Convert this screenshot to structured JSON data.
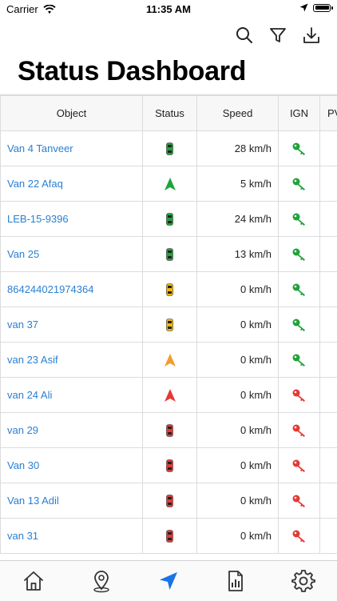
{
  "status_bar": {
    "carrier": "Carrier",
    "time": "11:35 AM"
  },
  "toolbar": {
    "icons": [
      "search-icon",
      "filter-icon",
      "download-icon"
    ]
  },
  "page_title": "Status Dashboard",
  "table": {
    "headers": [
      "Object",
      "Status",
      "Speed",
      "IGN",
      "PV"
    ],
    "rows": [
      {
        "object": "Van 4 Tanveer",
        "status": "parked-green",
        "speed": "28 km/h",
        "ign": "on"
      },
      {
        "object": "Van 22 Afaq",
        "status": "moving-green",
        "speed": "5 km/h",
        "ign": "on"
      },
      {
        "object": "LEB-15-9396",
        "status": "parked-green",
        "speed": "24 km/h",
        "ign": "on"
      },
      {
        "object": "Van 25",
        "status": "parked-green",
        "speed": "13 km/h",
        "ign": "on"
      },
      {
        "object": "864244021974364",
        "status": "parked-yellow",
        "speed": "0 km/h",
        "ign": "on"
      },
      {
        "object": "van 37",
        "status": "parked-yellow",
        "speed": "0 km/h",
        "ign": "on"
      },
      {
        "object": "van 23 Asif",
        "status": "moving-orange",
        "speed": "0 km/h",
        "ign": "on"
      },
      {
        "object": "van 24 Ali",
        "status": "moving-red",
        "speed": "0 km/h",
        "ign": "off"
      },
      {
        "object": "van 29",
        "status": "parked-red",
        "speed": "0 km/h",
        "ign": "off"
      },
      {
        "object": "Van 30",
        "status": "parked-red",
        "speed": "0 km/h",
        "ign": "off"
      },
      {
        "object": "Van 13 Adil",
        "status": "parked-red",
        "speed": "0 km/h",
        "ign": "off"
      },
      {
        "object": "van 31",
        "status": "parked-red",
        "speed": "0 km/h",
        "ign": "off"
      }
    ]
  },
  "colors": {
    "link": "#2a7fd2",
    "green": "#1fa33a",
    "yellow": "#f2b705",
    "orange": "#f39c2c",
    "red": "#e53935",
    "active_tab": "#1a73e8"
  },
  "tabbar": {
    "tabs": [
      "home-icon",
      "map-pin-icon",
      "navigation-icon",
      "report-icon",
      "settings-icon"
    ],
    "active_index": 2
  }
}
